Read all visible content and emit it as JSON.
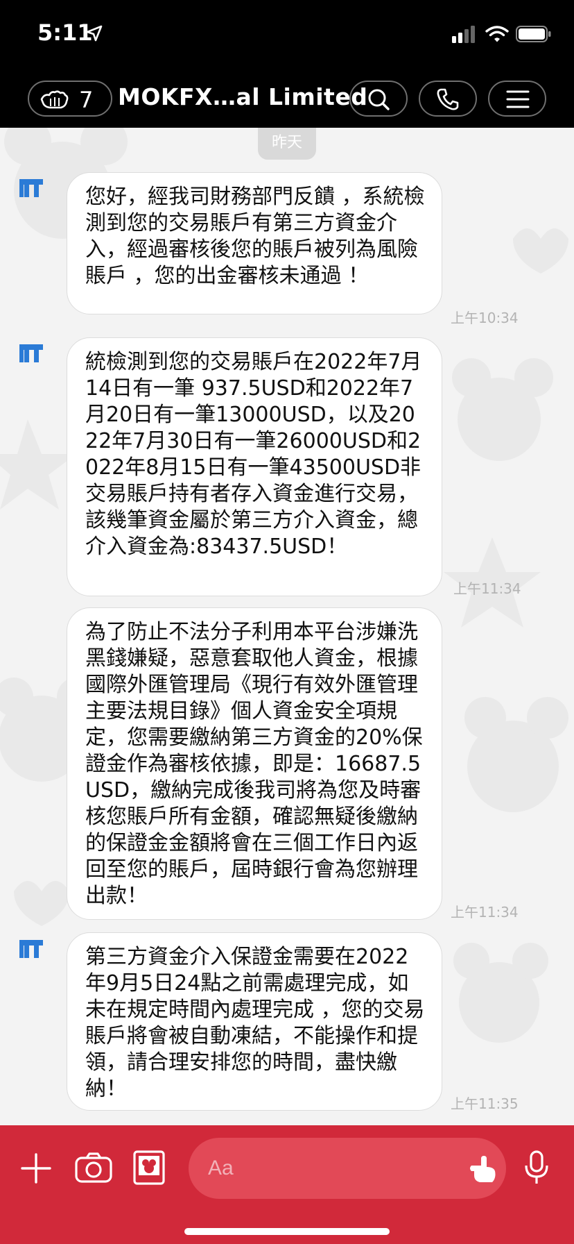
{
  "status_bar": {
    "time": "5:11"
  },
  "header": {
    "back_count": "7",
    "title": "MOKFX…al Limited"
  },
  "chat": {
    "date_separator": "昨天",
    "messages": [
      {
        "text": "您好，經我司財務部門反饋 ，系統檢測到您的交易賬戶有第三方資金介入，經過審核後您的賬戶被列為風險賬戶 ，您的出金審核未通過 ！",
        "time": "上午10:34",
        "show_avatar": true
      },
      {
        "text": "統檢測到您的交易賬戶在2022年7月14日有一筆 937.5USD和2022年7月20日有一筆13000USD，以及2022年7月30日有一筆26000USD和2022年8月15日有一筆43500USD非交易賬戶持有者存入資金進行交易，該幾筆資金屬於第三方介入資金，總介入資金為:83437.5USD！",
        "time": "上午11:34",
        "show_avatar": true
      },
      {
        "text": "為了防止不法分子利用本平台涉嫌洗黑錢嫌疑，惡意套取他人資金，根據國際外匯管理局《現行有效外匯管理主要法規目錄》個人資金安全項規定，您需要繳納第三方資金的20%保證金作為審核依據，即是：16687.5 USD，繳納完成後我司將為您及時審核您賬戶所有金額，確認無疑後繳納的保證金金額將會在三個工作日內返回至您的賬戶，屆時銀行會為您辦理出款！",
        "time": "上午11:34",
        "show_avatar": false
      },
      {
        "text": "第三方資金介入保證金需要在2022年9月5日24點之前需處理完成，如未在規定時間內處理完成 ，您的交易賬戶將會被自動凍結，不能操作和提領，請合理安排您的時間，盡快繳納！",
        "time": "上午11:35",
        "show_avatar": true
      }
    ]
  },
  "composer": {
    "placeholder": "Aa"
  },
  "icons": {
    "back": "hand-back-icon",
    "search": "search-icon",
    "call": "phone-icon",
    "menu": "hamburger-menu-icon",
    "add": "plus-icon",
    "camera": "camera-icon",
    "gallery": "image-icon",
    "emoji": "pointing-hand-icon",
    "mic": "microphone-icon"
  },
  "colors": {
    "header_bg": "#000000",
    "composer_bg": "#d1293a",
    "input_bg": "#e24957",
    "bubble_bg": "#ffffff",
    "avatar_blue": "#2b7bd6"
  }
}
